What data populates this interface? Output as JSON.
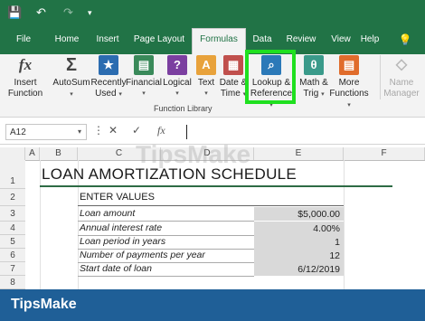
{
  "title_bar": {
    "save_icon": "save-icon",
    "undo_icon": "undo-icon",
    "redo_icon": "redo-icon",
    "customize_icon": "customize-qat-icon"
  },
  "tabs": [
    "File",
    "Home",
    "Insert",
    "Page Layout",
    "Formulas",
    "Data",
    "Review",
    "View",
    "Help"
  ],
  "active_tab": "Formulas",
  "help_icon": "lightbulb-icon",
  "ribbon": {
    "buttons": [
      {
        "label1": "Insert",
        "label2": "Function",
        "icon": "fx-icon",
        "glyph": "fx",
        "color": "#444444"
      },
      {
        "label1": "AutoSum",
        "label2": "",
        "icon": "sigma-icon",
        "glyph": "Σ",
        "color": "#444444"
      },
      {
        "label1": "Recently",
        "label2": "Used",
        "icon": "star-icon",
        "glyph": "★",
        "color": "#2b6cb0"
      },
      {
        "label1": "Financial",
        "label2": "",
        "icon": "financial-icon",
        "glyph": "▤",
        "color": "#3a8a5a"
      },
      {
        "label1": "Logical",
        "label2": "",
        "icon": "logical-icon",
        "glyph": "?",
        "color": "#7b3fa0"
      },
      {
        "label1": "Text",
        "label2": "",
        "icon": "text-icon",
        "glyph": "A",
        "color": "#e8a23b"
      },
      {
        "label1": "Date &",
        "label2": "Time",
        "icon": "calendar-icon",
        "glyph": "▦",
        "color": "#c0504d"
      },
      {
        "label1": "Lookup &",
        "label2": "Reference",
        "icon": "lookup-icon",
        "glyph": "⌕",
        "color": "#2b79b8"
      },
      {
        "label1": "Math &",
        "label2": "Trig",
        "icon": "math-icon",
        "glyph": "θ",
        "color": "#3a9a8a"
      },
      {
        "label1": "More",
        "label2": "Functions",
        "icon": "more-functions-icon",
        "glyph": "▤",
        "color": "#e06c2c"
      },
      {
        "label1": "Name",
        "label2": "Manager",
        "icon": "name-manager-icon",
        "glyph": "◇",
        "color": "#b8b8b8"
      }
    ],
    "group_label": "Function Library"
  },
  "formula_bar": {
    "name_box": "A12",
    "cancel": "✕",
    "enter": "✓",
    "fx": "fx",
    "formula": ""
  },
  "columns": [
    "A",
    "B",
    "C",
    "D",
    "E",
    "F"
  ],
  "rows": [
    "1",
    "2",
    "3",
    "4",
    "5",
    "6",
    "7",
    "8"
  ],
  "sheet": {
    "title": "LOAN AMORTIZATION SCHEDULE",
    "section": "ENTER VALUES",
    "items": [
      {
        "label": "Loan amount",
        "value": "$5,000.00"
      },
      {
        "label": "Annual interest rate",
        "value": "4.00%"
      },
      {
        "label": "Loan period in years",
        "value": "1"
      },
      {
        "label": "Number of payments per year",
        "value": "12"
      },
      {
        "label": "Start date of loan",
        "value": "6/12/2019"
      }
    ]
  },
  "watermark": "TipsMake",
  "brand": "TipsMake"
}
